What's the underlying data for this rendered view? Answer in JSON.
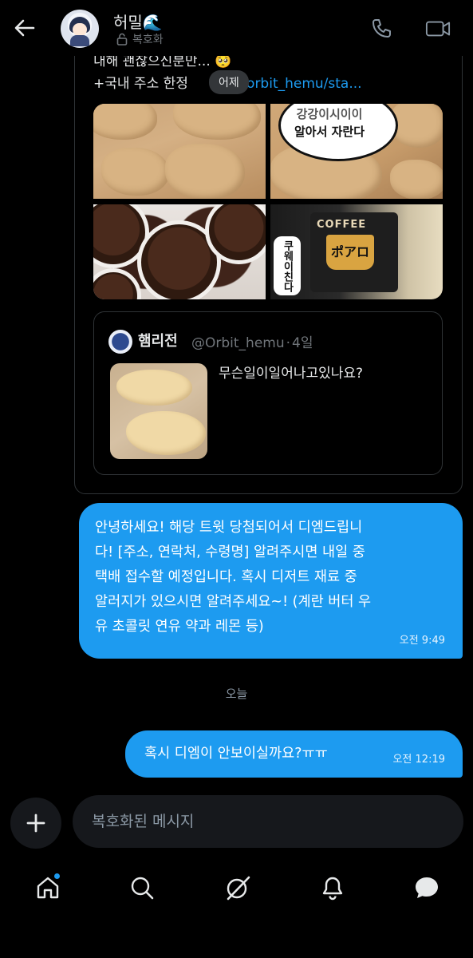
{
  "header": {
    "name": "허밀🌊",
    "subtitle": "복호화",
    "back_icon": "arrow-left-icon",
    "call_icon": "phone-icon",
    "video_icon": "video-icon"
  },
  "shared_tweet": {
    "text_line1": "내해 괜찮으신분만... 🥺",
    "text_line2_prefix": "+국내 주소 한정",
    "text_line2_link": "/orbit_hemu/sta...",
    "date_pill": "어제",
    "photo2_caption_line1": "강강이시이이",
    "photo2_caption_line2": "알아서 자란다",
    "photo4_mug_text": "COFFEE",
    "photo4_cup_text": "ポアロ",
    "photo4_sticker_text": "쿠웨이친다",
    "quote": {
      "name": "햄리전",
      "handle": "@Orbit_hemu",
      "separator": "·",
      "age": "4일",
      "text": "무슨일이일어나고있나요?"
    }
  },
  "messages": [
    {
      "text": "안녕하세요! 해당 트윗 당첨되어서 디엠드립니\n다! [주소, 연락처, 수령명] 알려주시면 내일 중\n택배 접수할 예정입니다. 혹시 디저트 재료 중\n알러지가 있으시면 알려주세요~! (계란 버터 우\n유 초콜릿 연유 약과 레몬 등)",
      "time": "오전 9:49"
    },
    {
      "text": "혹시 디엠이 안보이실까요?ㅠㅠ",
      "time": "오전 12:19"
    }
  ],
  "day_separator": "오늘",
  "composer": {
    "placeholder": "복호화된 메시지",
    "add_icon": "plus-icon"
  },
  "nav": {
    "items": [
      "home-icon",
      "search-icon",
      "grok-icon",
      "notifications-icon",
      "messages-icon"
    ]
  },
  "colors": {
    "accent": "#1d9bf0",
    "background": "#000000",
    "card_border": "#2f3336"
  }
}
